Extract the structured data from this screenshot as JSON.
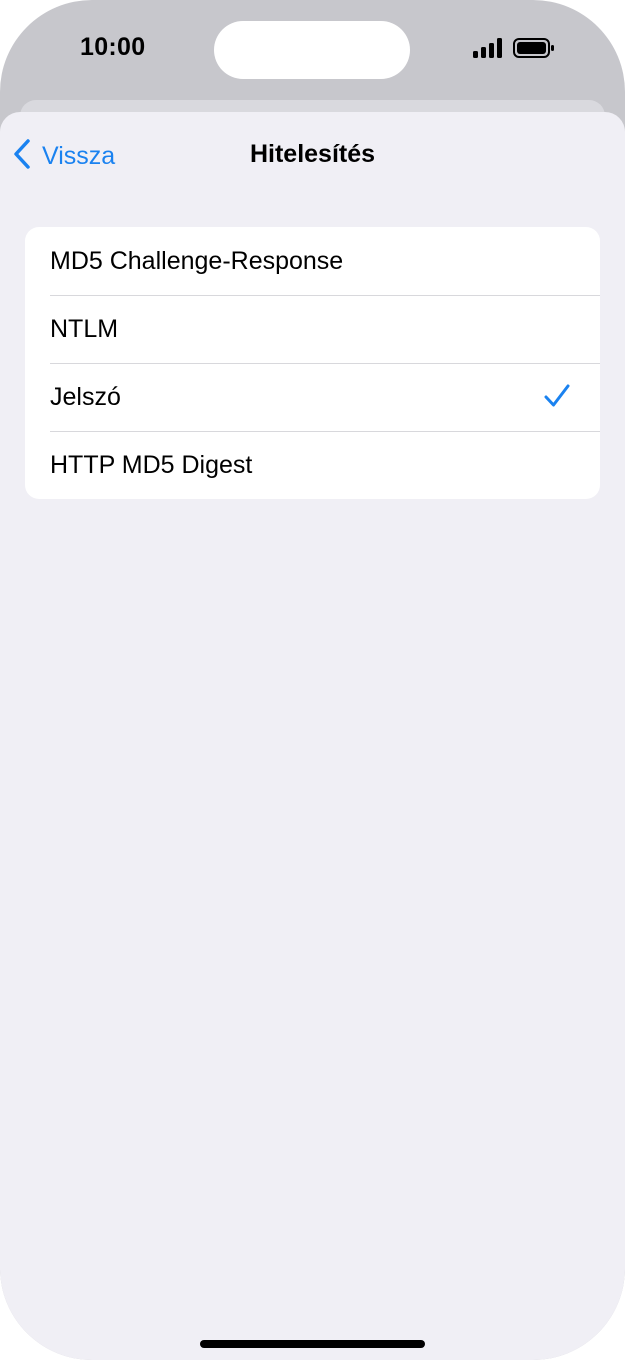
{
  "status_bar": {
    "time": "10:00",
    "icons": [
      "signal-icon",
      "battery-icon"
    ]
  },
  "nav": {
    "back_label": "Vissza",
    "title": "Hitelesítés"
  },
  "options": [
    {
      "label": "MD5 Challenge-Response",
      "selected": false
    },
    {
      "label": "NTLM",
      "selected": false
    },
    {
      "label": "Jelszó",
      "selected": true
    },
    {
      "label": "HTTP MD5 Digest",
      "selected": false
    }
  ],
  "colors": {
    "accent": "#1a82f0",
    "background": "#f0eff5",
    "card": "#ffffff"
  }
}
